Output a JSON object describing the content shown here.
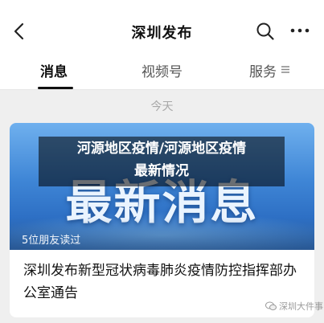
{
  "header": {
    "title": "深圳发布"
  },
  "tabs": [
    {
      "label": "消息"
    },
    {
      "label": "视频号"
    },
    {
      "label": "服务"
    }
  ],
  "feed": {
    "date_label": "今天",
    "article": {
      "cover_overlay_line1": "河源地区疫情/河源地区疫情",
      "cover_overlay_line2": "最新情况",
      "cover_big_text": "最新消息",
      "read_count": "5位朋友读过",
      "title": "深圳发布新型冠状病毒肺炎疫情防控指挥部办公室通告"
    },
    "watermark": "深圳大件事"
  },
  "colors": {
    "cover_top": "#6fb0ee",
    "cover_bottom": "#2d6fc4",
    "background": "#efefef"
  }
}
